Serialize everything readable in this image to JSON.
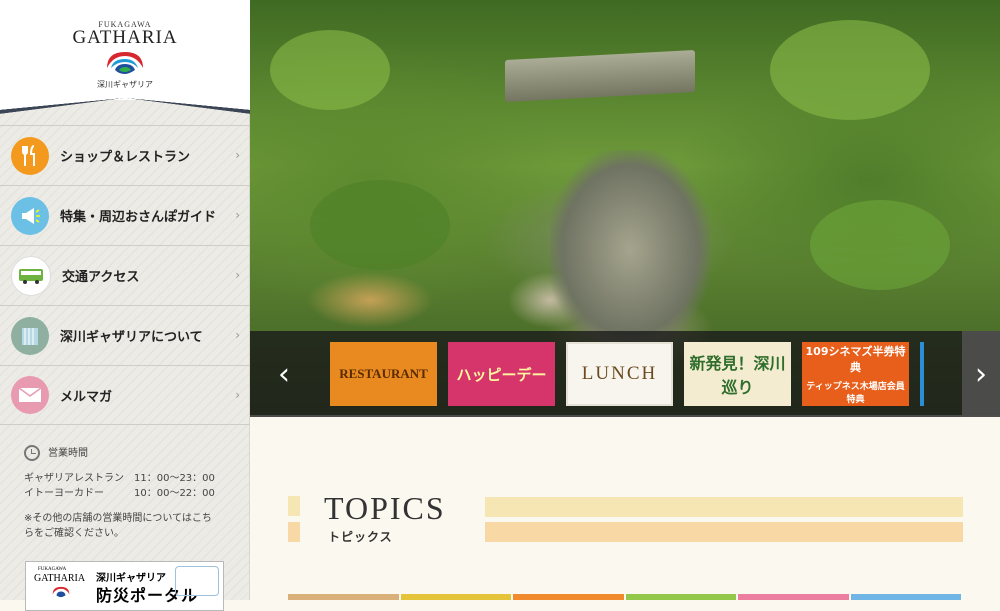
{
  "logo": {
    "small": "FUKAGAWA",
    "main": "GATHARIA",
    "jp": "深川ギャザリア"
  },
  "nav": [
    {
      "label": "ショップ＆レストラン",
      "icon": "fork-knife-icon",
      "color": "#f39a1e"
    },
    {
      "label": "特集・周辺おさんぽガイド",
      "icon": "megaphone-icon",
      "color": "#6cc0e5"
    },
    {
      "label": "交通アクセス",
      "icon": "bus-icon",
      "color": "#7bbd4a"
    },
    {
      "label": "深川ギャザリアについて",
      "icon": "building-icon",
      "color": "#8fb0a1"
    },
    {
      "label": "メルマガ",
      "icon": "envelope-icon",
      "color": "#e89ab1"
    }
  ],
  "hours": {
    "title": "営業時間",
    "rows": [
      {
        "name": "ギャザリアレストラン",
        "time": "11：00〜23：00"
      },
      {
        "name": "イトーヨーカドー",
        "time": "10：00〜22：00"
      }
    ],
    "note": "※その他の店舗の営業時間についてはこちらをご確認ください。"
  },
  "bousai": {
    "logo_small": "FUKAGAWA",
    "logo_main": "GATHARIA",
    "line1": "深川ギャザリア",
    "line2": "防災ポータル"
  },
  "banners": {
    "b1": "RESTAURANT",
    "b2": "ハッピーデー",
    "b3": "LUNCH",
    "b4": "新発見！深川巡り",
    "b5_top": "109シネマズ半券特典",
    "b5_bottom": "ティップネス木場店会員特典"
  },
  "topics": {
    "title": "TOPICS",
    "subtitle": "トピックス"
  },
  "colors": {
    "stripe": "#f6e6b4",
    "stripe2": "#f8d9a6",
    "nav_arrow": "#999999"
  },
  "color_bar": [
    "#d9b07a",
    "#e6c43a",
    "#f08a2c",
    "#94c84a",
    "#ec7fa0",
    "#6fb5e6"
  ]
}
